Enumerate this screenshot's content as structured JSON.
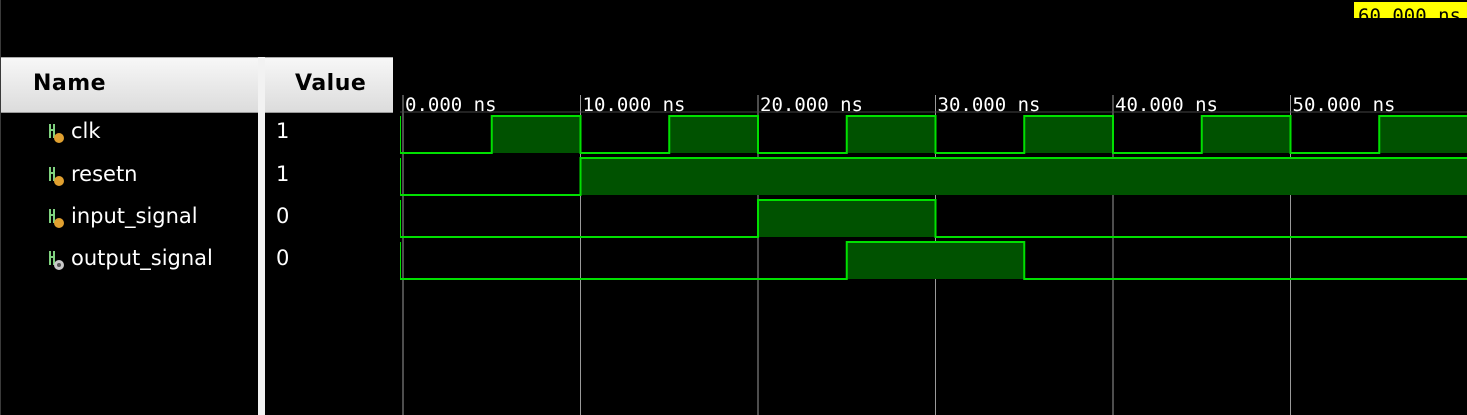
{
  "columns": {
    "name": "Name",
    "value": "Value"
  },
  "cursor": {
    "time_label": "60.000 ns"
  },
  "timeline": {
    "ticks": [
      "0.000 ns",
      "10.000 ns",
      "20.000 ns",
      "30.000 ns",
      "40.000 ns",
      "50.000 ns"
    ],
    "range_ns": [
      0,
      60
    ]
  },
  "signals": [
    {
      "name": "clk",
      "value": "1",
      "kind": "input"
    },
    {
      "name": "resetn",
      "value": "1",
      "kind": "input"
    },
    {
      "name": "input_signal",
      "value": "0",
      "kind": "input"
    },
    {
      "name": "output_signal",
      "value": "0",
      "kind": "output"
    }
  ],
  "waveforms": [
    {
      "name": "clk",
      "high_intervals_ns": [
        [
          5,
          10
        ],
        [
          15,
          20
        ],
        [
          25,
          30
        ],
        [
          35,
          40
        ],
        [
          45,
          50
        ],
        [
          55,
          60
        ]
      ]
    },
    {
      "name": "resetn",
      "high_intervals_ns": [
        [
          10,
          60
        ]
      ]
    },
    {
      "name": "input_signal",
      "high_intervals_ns": [
        [
          20,
          30
        ]
      ]
    },
    {
      "name": "output_signal",
      "high_intervals_ns": [
        [
          25,
          35
        ]
      ]
    }
  ],
  "colors": {
    "wave_line": "#00e000",
    "wave_fill": "#005200",
    "grid": "#9a9a9a",
    "cursor_bg": "#ffff00"
  }
}
